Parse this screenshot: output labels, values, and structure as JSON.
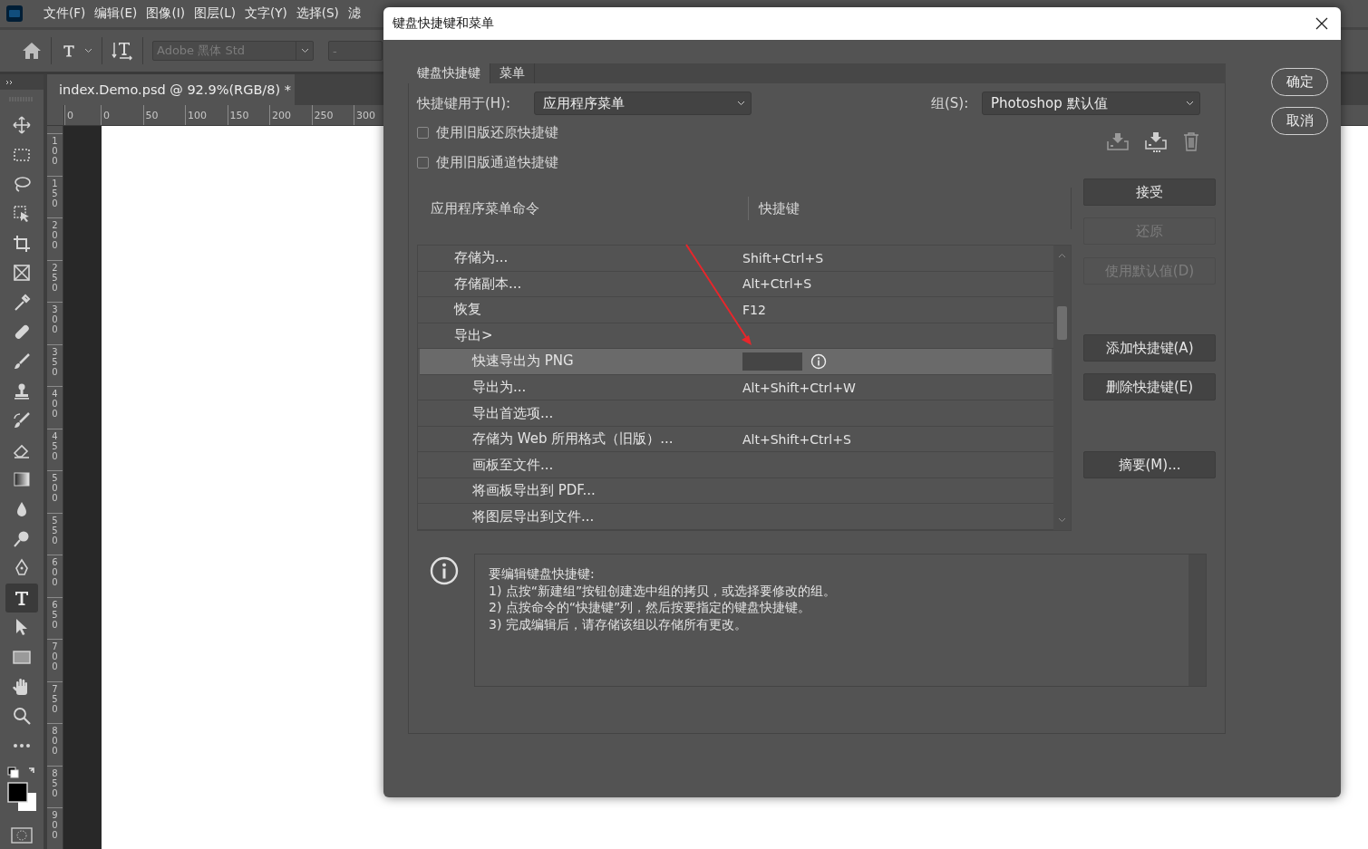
{
  "app": {
    "menu": [
      "文件(F)",
      "编辑(E)",
      "图像(I)",
      "图层(L)",
      "文字(Y)",
      "选择(S)",
      "滤"
    ],
    "options_bar": {
      "font_family": {
        "value": "Adobe 黑体 Std",
        "disabled": true
      },
      "font_style": {
        "value": "-",
        "disabled": true
      }
    },
    "document_tab": {
      "title": "index.Demo.psd @ 92.9%(RGB/8) *"
    },
    "rulers": {
      "horizontal": [
        "0",
        "0",
        "50",
        "100",
        "150",
        "200",
        "250",
        "300"
      ],
      "vertical": [
        "100",
        "150",
        "200",
        "250",
        "300",
        "350",
        "400",
        "450",
        "500",
        "550",
        "600",
        "650",
        "700",
        "750",
        "800",
        "850",
        "900"
      ]
    },
    "tools": [
      {
        "selected": false
      },
      {
        "selected": false
      },
      {
        "selected": false
      },
      {
        "selected": false
      },
      {
        "selected": false
      },
      {
        "selected": false
      },
      {
        "selected": false
      },
      {
        "selected": false
      },
      {
        "selected": false
      },
      {
        "selected": false
      },
      {
        "selected": false
      },
      {
        "selected": false
      },
      {
        "selected": false
      },
      {
        "selected": false
      },
      {
        "selected": false
      },
      {
        "selected": false
      },
      {
        "selected": true
      },
      {
        "selected": false
      },
      {
        "selected": false
      },
      {
        "selected": false
      },
      {
        "selected": false
      },
      {
        "selected": false
      }
    ]
  },
  "dialog": {
    "title": "键盘快捷键和菜单",
    "tabs": [
      {
        "label": "键盘快捷键",
        "selected": true
      },
      {
        "label": "菜单",
        "selected": false
      }
    ],
    "shortcuts_for": {
      "label": "快捷键用于(H):",
      "value": "应用程序菜单"
    },
    "set": {
      "label": "组(S):",
      "value": "Photoshop 默认值"
    },
    "options": [
      {
        "label": "使用旧版还原快捷键",
        "checked": false
      },
      {
        "label": "使用旧版通道快捷键",
        "checked": false
      }
    ],
    "table": {
      "columns": [
        "应用程序菜单命令",
        "快捷键"
      ],
      "rows": [
        {
          "command": "存储为...",
          "shortcut": "Shift+Ctrl+S",
          "selected": false
        },
        {
          "command": "存储副本...",
          "shortcut": "Alt+Ctrl+S",
          "selected": false
        },
        {
          "command": "恢复",
          "shortcut": "F12",
          "selected": false
        },
        {
          "command": "导出>",
          "selected": false,
          "children": [
            {
              "command": "快速导出为 PNG",
              "selected": true,
              "editing": true
            },
            {
              "command": "导出为...",
              "shortcut": "Alt+Shift+Ctrl+W",
              "selected": false
            },
            {
              "command": "导出首选项...",
              "selected": false
            },
            {
              "command": "存储为 Web 所用格式（旧版）...",
              "shortcut": "Alt+Shift+Ctrl+S",
              "selected": false
            },
            {
              "command": "画板至文件...",
              "selected": false
            },
            {
              "command": "将画板导出到 PDF...",
              "selected": false
            },
            {
              "command": "将图层导出到文件...",
              "selected": false
            }
          ]
        }
      ]
    },
    "buttons": [
      {
        "label": "接受",
        "disabled": false
      },
      {
        "label": "还原",
        "disabled": true
      },
      {
        "label": "使用默认值(D)",
        "disabled": true
      },
      {
        "label": "添加快捷键(A)",
        "disabled": false
      },
      {
        "label": "删除快捷键(E)",
        "disabled": false
      },
      {
        "label": "摘要(M)...",
        "disabled": false
      }
    ],
    "dialog_buttons": [
      "确定",
      "取消"
    ],
    "info": {
      "lines": [
        "要编辑键盘快捷键:",
        "1) 点按“新建组”按钮创建选中组的拷贝，或选择要修改的组。",
        "2) 点按命令的“快捷键”列，然后按要指定的键盘快捷键。",
        "3) 完成编辑后，请存储该组以存储所有更改。"
      ]
    }
  }
}
